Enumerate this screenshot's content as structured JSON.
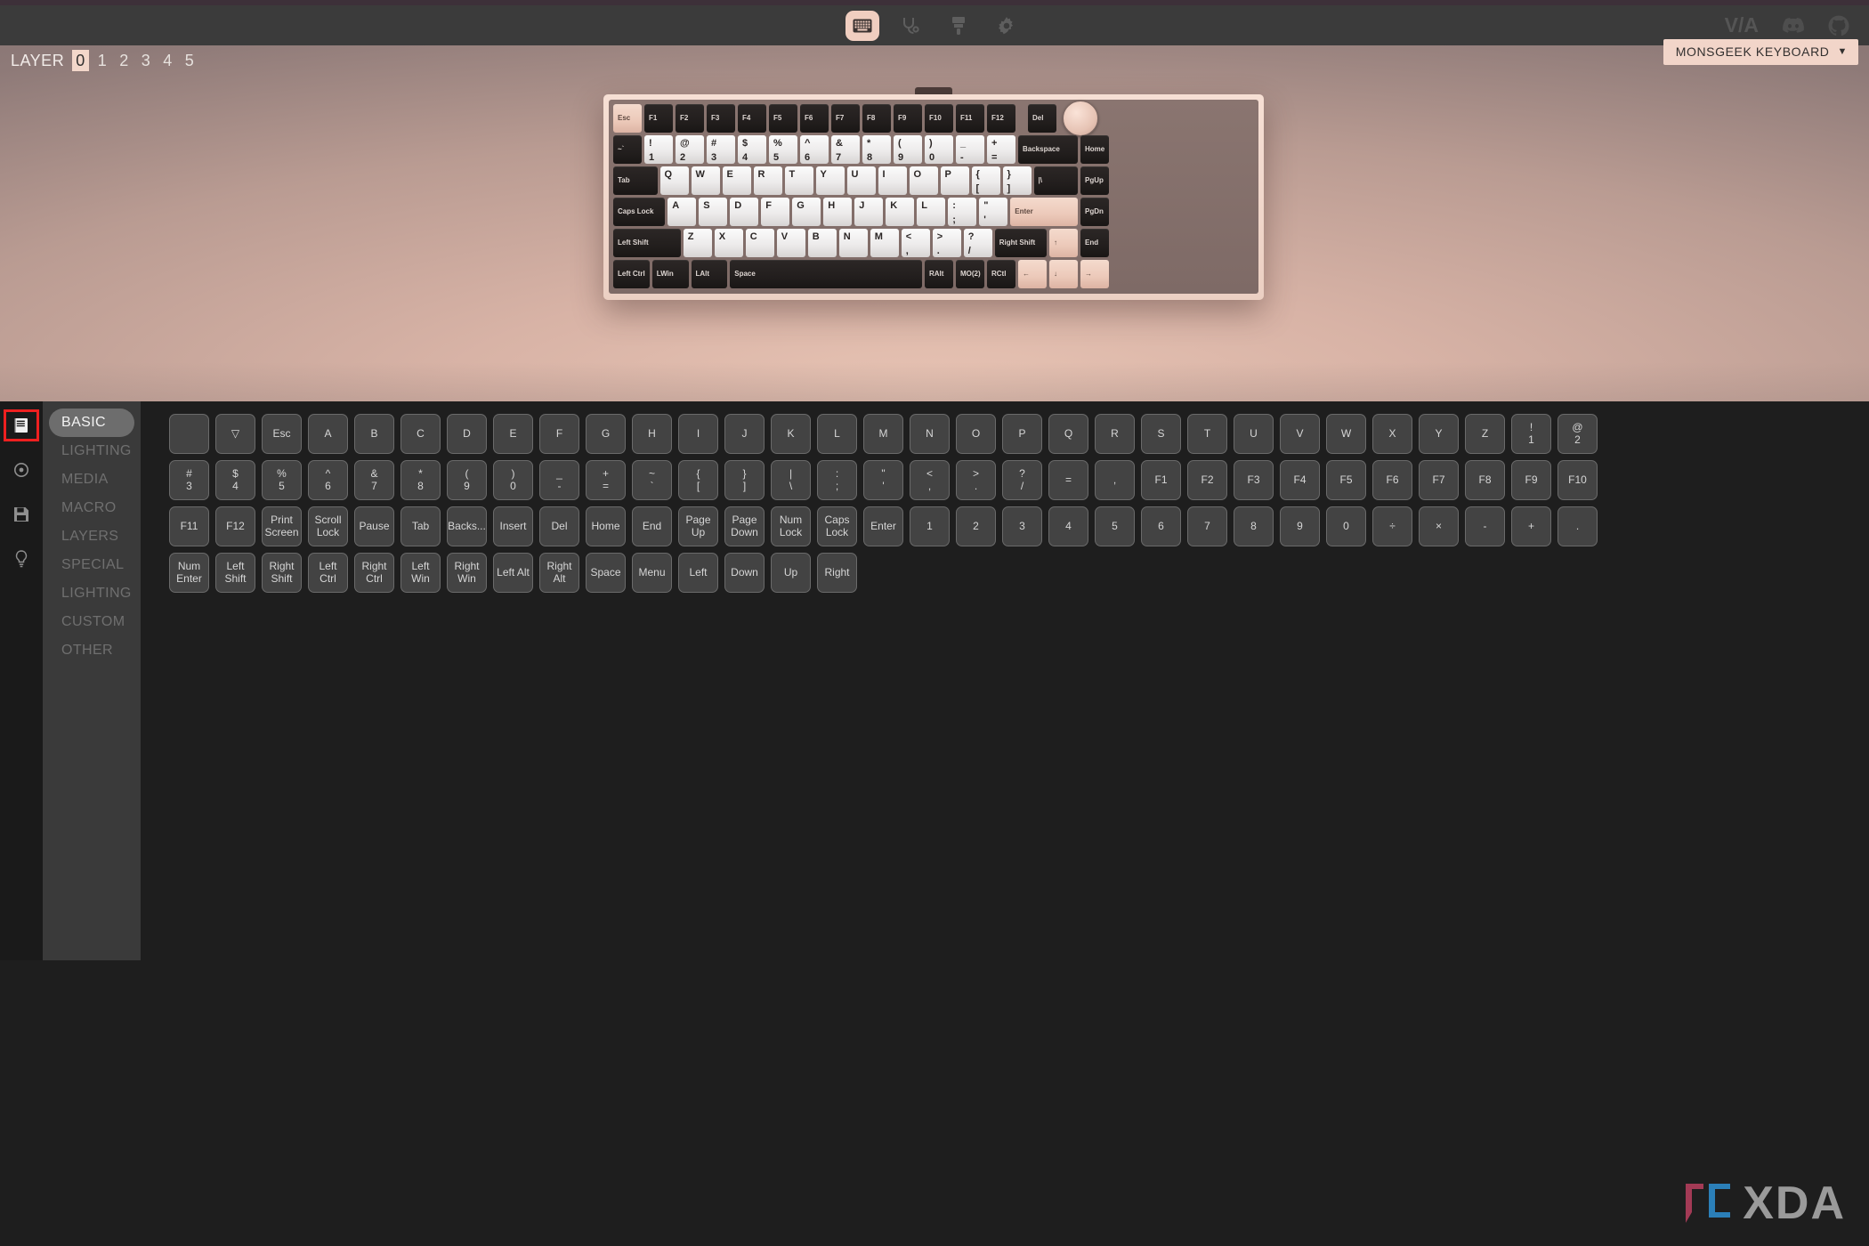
{
  "window": {
    "accent": "#f0cec0",
    "panel_bg": "#1e1e1e"
  },
  "toolbar": {
    "items": [
      {
        "name": "keyboard-icon",
        "label": "Keyboard",
        "active": true
      },
      {
        "name": "stethoscope-icon",
        "label": "Key Tester",
        "active": false
      },
      {
        "name": "paintbrush-icon",
        "label": "Lighting",
        "active": false
      },
      {
        "name": "gear-icon",
        "label": "Settings",
        "active": false
      }
    ],
    "via_label": "V/A",
    "discord_label": "Discord",
    "github_label": "GitHub"
  },
  "layer_bar": {
    "label": "LAYER",
    "layers": [
      "0",
      "1",
      "2",
      "3",
      "4",
      "5"
    ],
    "selected": "0"
  },
  "keyboard_select": {
    "value": "MONSGEEK KEYBOARD",
    "chevron": "⌄"
  },
  "keyboard_preview": {
    "rows": [
      [
        {
          "t": "Esc",
          "s": "ac",
          "w": 1
        },
        {
          "t": "F1",
          "w": 1
        },
        {
          "t": "F2",
          "w": 1
        },
        {
          "t": "F3",
          "w": 1
        },
        {
          "t": "F4",
          "w": 1
        },
        {
          "t": "F5",
          "w": 1
        },
        {
          "t": "F6",
          "w": 1
        },
        {
          "t": "F7",
          "w": 1
        },
        {
          "t": "F8",
          "w": 1
        },
        {
          "t": "F9",
          "w": 1
        },
        {
          "t": "F10",
          "w": 1
        },
        {
          "t": "F11",
          "w": 1
        },
        {
          "t": "F12",
          "w": 1
        },
        {
          "t": "",
          "w": 0.25,
          "s": "gap"
        },
        {
          "t": "Del",
          "w": 1
        },
        {
          "t": "KNOB",
          "s": "knob",
          "w": 1
        }
      ],
      [
        {
          "t": "~\n`",
          "w": 1
        },
        {
          "t": "!\n1",
          "s": "lt",
          "w": 1
        },
        {
          "t": "@\n2",
          "s": "lt",
          "w": 1
        },
        {
          "t": "#\n3",
          "s": "lt",
          "w": 1
        },
        {
          "t": "$\n4",
          "s": "lt",
          "w": 1
        },
        {
          "t": "%\n5",
          "s": "lt",
          "w": 1
        },
        {
          "t": "^\n6",
          "s": "lt",
          "w": 1
        },
        {
          "t": "&\n7",
          "s": "lt",
          "w": 1
        },
        {
          "t": "*\n8",
          "s": "lt",
          "w": 1
        },
        {
          "t": "(\n9",
          "s": "lt",
          "w": 1
        },
        {
          "t": ")\n0",
          "s": "lt",
          "w": 1
        },
        {
          "t": "_\n-",
          "s": "lt",
          "w": 1
        },
        {
          "t": "+\n=",
          "s": "lt",
          "w": 1
        },
        {
          "t": "Backspace",
          "w": 2
        },
        {
          "t": "Home",
          "w": 1
        }
      ],
      [
        {
          "t": "Tab",
          "w": 1.5
        },
        {
          "t": "Q",
          "s": "lt",
          "w": 1
        },
        {
          "t": "W",
          "s": "lt",
          "w": 1
        },
        {
          "t": "E",
          "s": "lt",
          "w": 1
        },
        {
          "t": "R",
          "s": "lt",
          "w": 1
        },
        {
          "t": "T",
          "s": "lt",
          "w": 1
        },
        {
          "t": "Y",
          "s": "lt",
          "w": 1
        },
        {
          "t": "U",
          "s": "lt",
          "w": 1
        },
        {
          "t": "I",
          "s": "lt",
          "w": 1
        },
        {
          "t": "O",
          "s": "lt",
          "w": 1
        },
        {
          "t": "P",
          "s": "lt",
          "w": 1
        },
        {
          "t": "{\n[",
          "s": "lt",
          "w": 1
        },
        {
          "t": "}\n]",
          "s": "lt",
          "w": 1
        },
        {
          "t": "|\n\\",
          "w": 1.5
        },
        {
          "t": "PgUp",
          "w": 1
        }
      ],
      [
        {
          "t": "Caps Lock",
          "w": 1.75
        },
        {
          "t": "A",
          "s": "lt",
          "w": 1
        },
        {
          "t": "S",
          "s": "lt",
          "w": 1
        },
        {
          "t": "D",
          "s": "lt",
          "w": 1
        },
        {
          "t": "F",
          "s": "lt",
          "w": 1
        },
        {
          "t": "G",
          "s": "lt",
          "w": 1
        },
        {
          "t": "H",
          "s": "lt",
          "w": 1
        },
        {
          "t": "J",
          "s": "lt",
          "w": 1
        },
        {
          "t": "K",
          "s": "lt",
          "w": 1
        },
        {
          "t": "L",
          "s": "lt",
          "w": 1
        },
        {
          "t": ":\n;",
          "s": "lt",
          "w": 1
        },
        {
          "t": "\"\n'",
          "s": "lt",
          "w": 1
        },
        {
          "t": "Enter",
          "s": "ac",
          "w": 2.25
        },
        {
          "t": "PgDn",
          "w": 1
        }
      ],
      [
        {
          "t": "Left Shift",
          "w": 2.25
        },
        {
          "t": "Z",
          "s": "lt",
          "w": 1
        },
        {
          "t": "X",
          "s": "lt",
          "w": 1
        },
        {
          "t": "C",
          "s": "lt",
          "w": 1
        },
        {
          "t": "V",
          "s": "lt",
          "w": 1
        },
        {
          "t": "B",
          "s": "lt",
          "w": 1
        },
        {
          "t": "N",
          "s": "lt",
          "w": 1
        },
        {
          "t": "M",
          "s": "lt",
          "w": 1
        },
        {
          "t": "<\n,",
          "s": "lt",
          "w": 1
        },
        {
          "t": ">\n.",
          "s": "lt",
          "w": 1
        },
        {
          "t": "?\n/",
          "s": "lt",
          "w": 1
        },
        {
          "t": "Right Shift",
          "w": 1.75
        },
        {
          "t": "↑",
          "s": "ac",
          "w": 1
        },
        {
          "t": "End",
          "w": 1
        }
      ],
      [
        {
          "t": "Left Ctrl",
          "w": 1.25
        },
        {
          "t": "LWin",
          "w": 1.25
        },
        {
          "t": "LAlt",
          "w": 1.25
        },
        {
          "t": "Space",
          "w": 6.25
        },
        {
          "t": "RAlt",
          "w": 1
        },
        {
          "t": "MO(2)",
          "w": 1
        },
        {
          "t": "RCtl",
          "w": 1
        },
        {
          "t": "←",
          "s": "ac",
          "w": 1
        },
        {
          "t": "↓",
          "s": "ac",
          "w": 1
        },
        {
          "t": "→",
          "s": "ac",
          "w": 1
        }
      ]
    ]
  },
  "rail": {
    "items": [
      {
        "name": "keymap-icon",
        "label": "Keymap",
        "selected": true
      },
      {
        "name": "record-icon",
        "label": "Key Tester",
        "selected": false
      },
      {
        "name": "save-icon",
        "label": "Save + Load",
        "selected": false
      },
      {
        "name": "bulb-icon",
        "label": "Lighting",
        "selected": false
      }
    ]
  },
  "sidebar": {
    "items": [
      {
        "label": "BASIC",
        "active": true
      },
      {
        "label": "LIGHTING",
        "active": false
      },
      {
        "label": "MEDIA",
        "active": false
      },
      {
        "label": "MACRO",
        "active": false
      },
      {
        "label": "LAYERS",
        "active": false
      },
      {
        "label": "SPECIAL",
        "active": false
      },
      {
        "label": "LIGHTING",
        "active": false
      },
      {
        "label": "CUSTOM",
        "active": false
      },
      {
        "label": "OTHER",
        "active": false
      }
    ]
  },
  "keycode_picker": {
    "rows": [
      [
        {
          "l1": "",
          "l2": "",
          "blank": true
        },
        {
          "l1": "▽",
          "l2": ""
        },
        {
          "l1": "Esc",
          "l2": ""
        },
        {
          "l1": "A",
          "l2": ""
        },
        {
          "l1": "B",
          "l2": ""
        },
        {
          "l1": "C",
          "l2": ""
        },
        {
          "l1": "D",
          "l2": ""
        },
        {
          "l1": "E",
          "l2": ""
        },
        {
          "l1": "F",
          "l2": ""
        },
        {
          "l1": "G",
          "l2": ""
        },
        {
          "l1": "H",
          "l2": ""
        },
        {
          "l1": "I",
          "l2": ""
        },
        {
          "l1": "J",
          "l2": ""
        },
        {
          "l1": "K",
          "l2": ""
        },
        {
          "l1": "L",
          "l2": ""
        },
        {
          "l1": "M",
          "l2": ""
        },
        {
          "l1": "N",
          "l2": ""
        },
        {
          "l1": "O",
          "l2": ""
        },
        {
          "l1": "P",
          "l2": ""
        },
        {
          "l1": "Q",
          "l2": ""
        },
        {
          "l1": "R",
          "l2": ""
        },
        {
          "l1": "S",
          "l2": ""
        },
        {
          "l1": "T",
          "l2": ""
        },
        {
          "l1": "U",
          "l2": ""
        },
        {
          "l1": "V",
          "l2": ""
        },
        {
          "l1": "W",
          "l2": ""
        },
        {
          "l1": "X",
          "l2": ""
        },
        {
          "l1": "Y",
          "l2": ""
        },
        {
          "l1": "Z",
          "l2": ""
        },
        {
          "l1": "!",
          "l2": "1"
        },
        {
          "l1": "@",
          "l2": "2"
        }
      ],
      [
        {
          "l1": "#",
          "l2": "3"
        },
        {
          "l1": "$",
          "l2": "4"
        },
        {
          "l1": "%",
          "l2": "5"
        },
        {
          "l1": "^",
          "l2": "6"
        },
        {
          "l1": "&",
          "l2": "7"
        },
        {
          "l1": "*",
          "l2": "8"
        },
        {
          "l1": "(",
          "l2": "9"
        },
        {
          "l1": ")",
          "l2": "0"
        },
        {
          "l1": "_",
          "l2": "-"
        },
        {
          "l1": "+",
          "l2": "="
        },
        {
          "l1": "~",
          "l2": "`"
        },
        {
          "l1": "{",
          "l2": "["
        },
        {
          "l1": "}",
          "l2": "]"
        },
        {
          "l1": "|",
          "l2": "\\"
        },
        {
          "l1": ":",
          "l2": ";"
        },
        {
          "l1": "\"",
          "l2": "'"
        },
        {
          "l1": "<",
          "l2": ","
        },
        {
          "l1": ">",
          "l2": "."
        },
        {
          "l1": "?",
          "l2": "/"
        },
        {
          "l1": "=",
          "l2": ""
        },
        {
          "l1": ",",
          "l2": ""
        },
        {
          "l1": "F1",
          "l2": ""
        },
        {
          "l1": "F2",
          "l2": ""
        },
        {
          "l1": "F3",
          "l2": ""
        },
        {
          "l1": "F4",
          "l2": ""
        },
        {
          "l1": "F5",
          "l2": ""
        },
        {
          "l1": "F6",
          "l2": ""
        },
        {
          "l1": "F7",
          "l2": ""
        },
        {
          "l1": "F8",
          "l2": ""
        },
        {
          "l1": "F9",
          "l2": ""
        },
        {
          "l1": "F10",
          "l2": ""
        }
      ],
      [
        {
          "l1": "F11",
          "l2": ""
        },
        {
          "l1": "F12",
          "l2": ""
        },
        {
          "l1": "Print",
          "l2": "Screen"
        },
        {
          "l1": "Scroll",
          "l2": "Lock"
        },
        {
          "l1": "Pause",
          "l2": ""
        },
        {
          "l1": "Tab",
          "l2": ""
        },
        {
          "l1": "Backs...",
          "l2": ""
        },
        {
          "l1": "Insert",
          "l2": ""
        },
        {
          "l1": "Del",
          "l2": ""
        },
        {
          "l1": "Home",
          "l2": ""
        },
        {
          "l1": "End",
          "l2": ""
        },
        {
          "l1": "Page",
          "l2": "Up"
        },
        {
          "l1": "Page",
          "l2": "Down"
        },
        {
          "l1": "Num",
          "l2": "Lock"
        },
        {
          "l1": "Caps",
          "l2": "Lock"
        },
        {
          "l1": "Enter",
          "l2": ""
        },
        {
          "l1": "1",
          "l2": ""
        },
        {
          "l1": "2",
          "l2": ""
        },
        {
          "l1": "3",
          "l2": ""
        },
        {
          "l1": "4",
          "l2": ""
        },
        {
          "l1": "5",
          "l2": ""
        },
        {
          "l1": "6",
          "l2": ""
        },
        {
          "l1": "7",
          "l2": ""
        },
        {
          "l1": "8",
          "l2": ""
        },
        {
          "l1": "9",
          "l2": ""
        },
        {
          "l1": "0",
          "l2": ""
        },
        {
          "l1": "÷",
          "l2": ""
        },
        {
          "l1": "×",
          "l2": ""
        },
        {
          "l1": "-",
          "l2": ""
        },
        {
          "l1": "+",
          "l2": ""
        },
        {
          "l1": ".",
          "l2": ""
        }
      ],
      [
        {
          "l1": "Num",
          "l2": "Enter"
        },
        {
          "l1": "Left",
          "l2": "Shift"
        },
        {
          "l1": "Right",
          "l2": "Shift"
        },
        {
          "l1": "Left Ctrl",
          "l2": ""
        },
        {
          "l1": "Right",
          "l2": "Ctrl"
        },
        {
          "l1": "Left",
          "l2": "Win"
        },
        {
          "l1": "Right",
          "l2": "Win"
        },
        {
          "l1": "Left Alt",
          "l2": ""
        },
        {
          "l1": "Right",
          "l2": "Alt"
        },
        {
          "l1": "Space",
          "l2": ""
        },
        {
          "l1": "Menu",
          "l2": ""
        },
        {
          "l1": "Left",
          "l2": ""
        },
        {
          "l1": "Down",
          "l2": ""
        },
        {
          "l1": "Up",
          "l2": ""
        },
        {
          "l1": "Right",
          "l2": ""
        }
      ]
    ]
  },
  "watermark": {
    "text": "XDA",
    "bracket_left_color": "#a33a55",
    "bracket_right_color": "#2b7fb8"
  }
}
